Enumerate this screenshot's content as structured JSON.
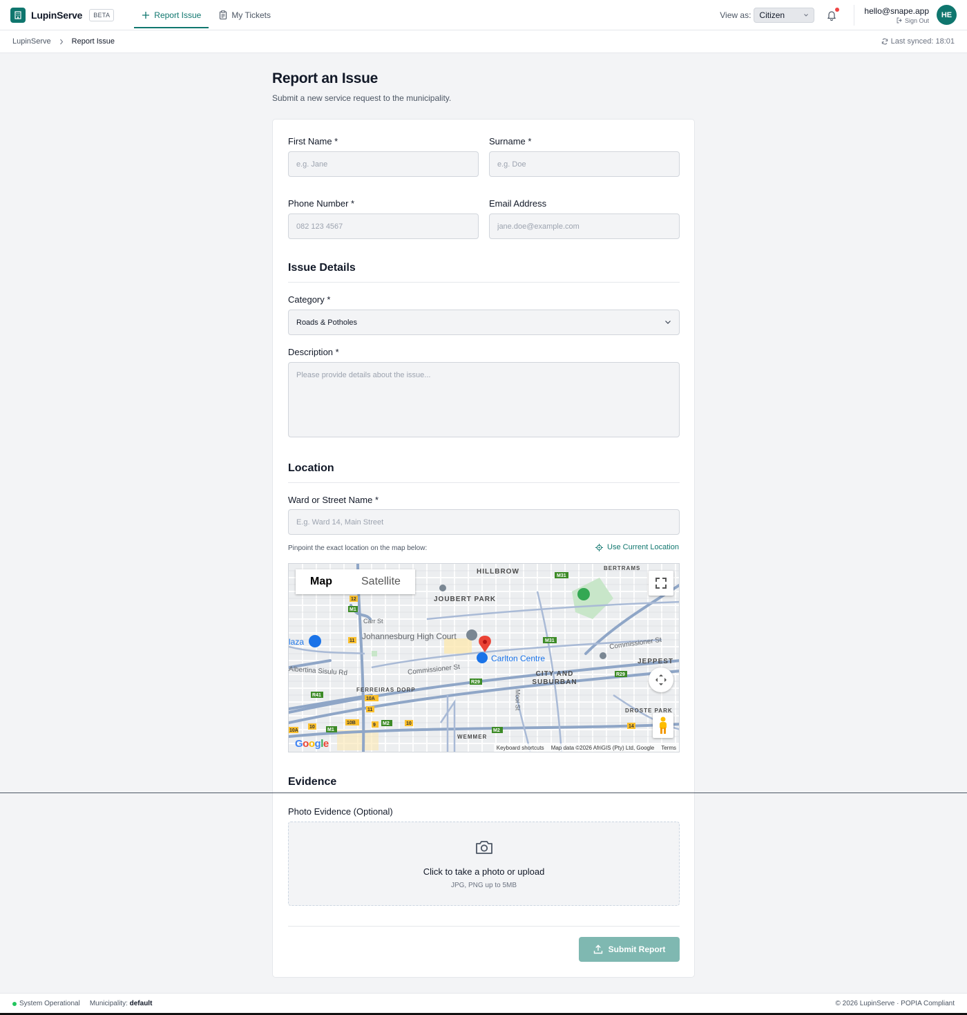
{
  "app": {
    "name": "LupinServe",
    "badge": "BETA"
  },
  "nav": {
    "items": [
      {
        "label": "Report Issue",
        "active": true
      },
      {
        "label": "My Tickets",
        "active": false
      }
    ]
  },
  "header": {
    "view_as_label": "View as:",
    "view_as_value": "Citizen",
    "user_email": "hello@snape.app",
    "sign_out": "Sign Out",
    "avatar_initials": "HE"
  },
  "breadcrumb": {
    "root": "LupinServe",
    "current": "Report Issue",
    "last_synced": "Last synced: 18:01"
  },
  "page": {
    "title": "Report an Issue",
    "subtitle": "Submit a new service request to the municipality."
  },
  "form": {
    "first_name": {
      "label": "First Name *",
      "placeholder": "e.g. Jane"
    },
    "surname": {
      "label": "Surname *",
      "placeholder": "e.g. Doe"
    },
    "phone": {
      "label": "Phone Number *",
      "placeholder": "082 123 4567"
    },
    "email": {
      "label": "Email Address",
      "placeholder": "jane.doe@example.com"
    },
    "issue_section": "Issue Details",
    "category": {
      "label": "Category *",
      "value": "Roads & Potholes"
    },
    "description": {
      "label": "Description *",
      "placeholder": "Please provide details about the issue..."
    },
    "location_section": "Location",
    "ward": {
      "label": "Ward or Street Name *",
      "placeholder": "E.g. Ward 14, Main Street"
    },
    "pinpoint_hint": "Pinpoint the exact location on the map below:",
    "use_current_location": "Use Current Location",
    "evidence_section": "Evidence",
    "photo": {
      "label": "Photo Evidence (Optional)",
      "title": "Click to take a photo or upload",
      "subtitle": "JPG, PNG up to 5MB"
    },
    "submit": "Submit Report"
  },
  "map": {
    "tabs": [
      "Map",
      "Satellite"
    ],
    "labels": {
      "hillbrow": "HILLBROW",
      "bertrams": "BERTRAMS",
      "joubert_park": "JOUBERT PARK",
      "court": "Johannesburg High Court",
      "carlton": "Carlton Centre",
      "commissioner1": "Commissioner St",
      "commissioner2": "Commissioner St",
      "city_suburban": "CITY AND SUBURBAN",
      "jeppest": "JEPPEST",
      "ferreiras": "FERREIRAS DORP",
      "albertina": "Albertina Sisulu Rd",
      "plaza": "laza",
      "carr": "Carr St",
      "mooi": "Mooi St",
      "wemmer": "WEMMER",
      "droste": "DROSTE PARK"
    },
    "footer": [
      "Keyboard shortcuts",
      "Map data ©2026 AfriGIS (Pty) Ltd, Google",
      "Terms"
    ],
    "google": "Google"
  },
  "footer": {
    "status": "System Operational",
    "municipality_label": "Municipality:",
    "municipality_value": "default",
    "copyright": "© 2026 LupinServe · POPIA Compliant"
  }
}
